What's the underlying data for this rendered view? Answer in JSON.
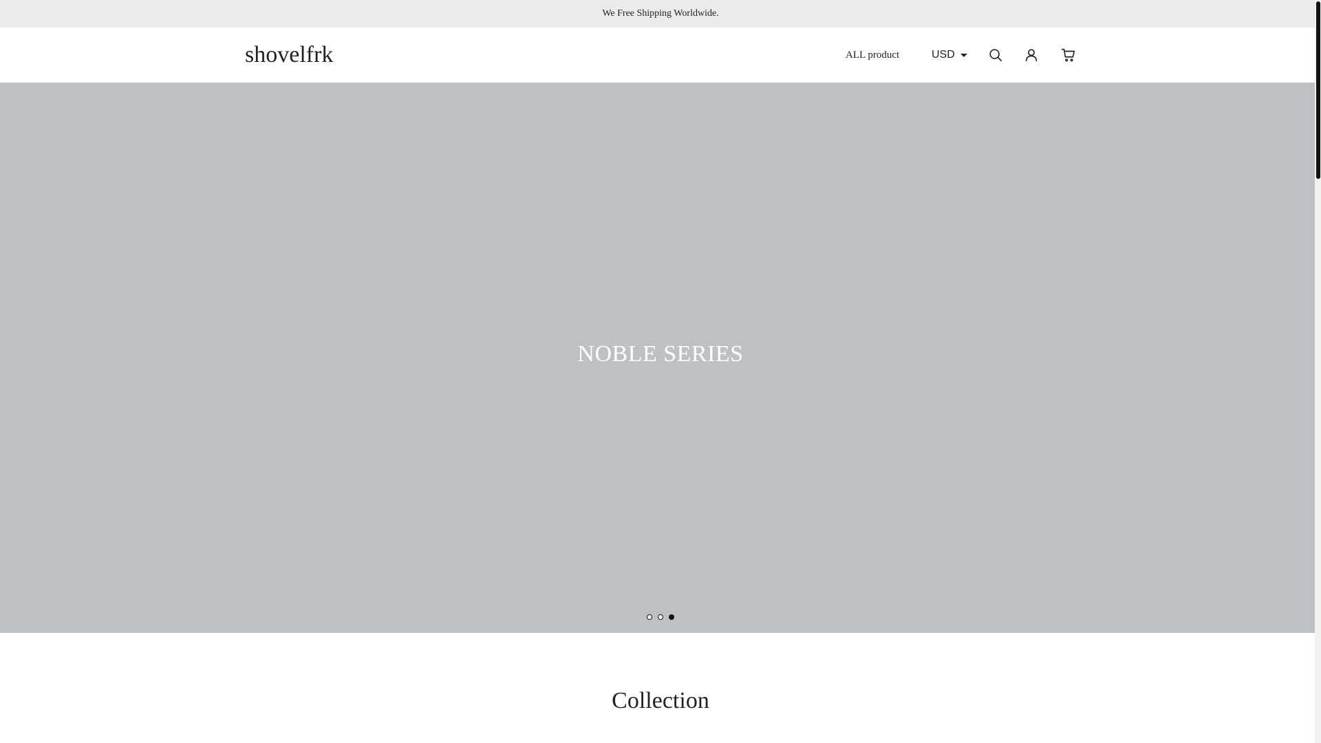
{
  "announcement": {
    "text": "We Free Shipping Worldwide."
  },
  "header": {
    "logo": "shovelfrk",
    "nav": {
      "all_product": "ALL product"
    },
    "currency": {
      "selected": "USD"
    },
    "icons": {
      "search": "search-icon",
      "account": "user-icon",
      "cart": "cart-icon"
    }
  },
  "hero": {
    "title": "NOBLE SERIES",
    "background_color": "#bfc0c4",
    "slides": [
      "1",
      "2",
      "3"
    ],
    "active_slide": 3
  },
  "collection": {
    "title": "Collection"
  }
}
